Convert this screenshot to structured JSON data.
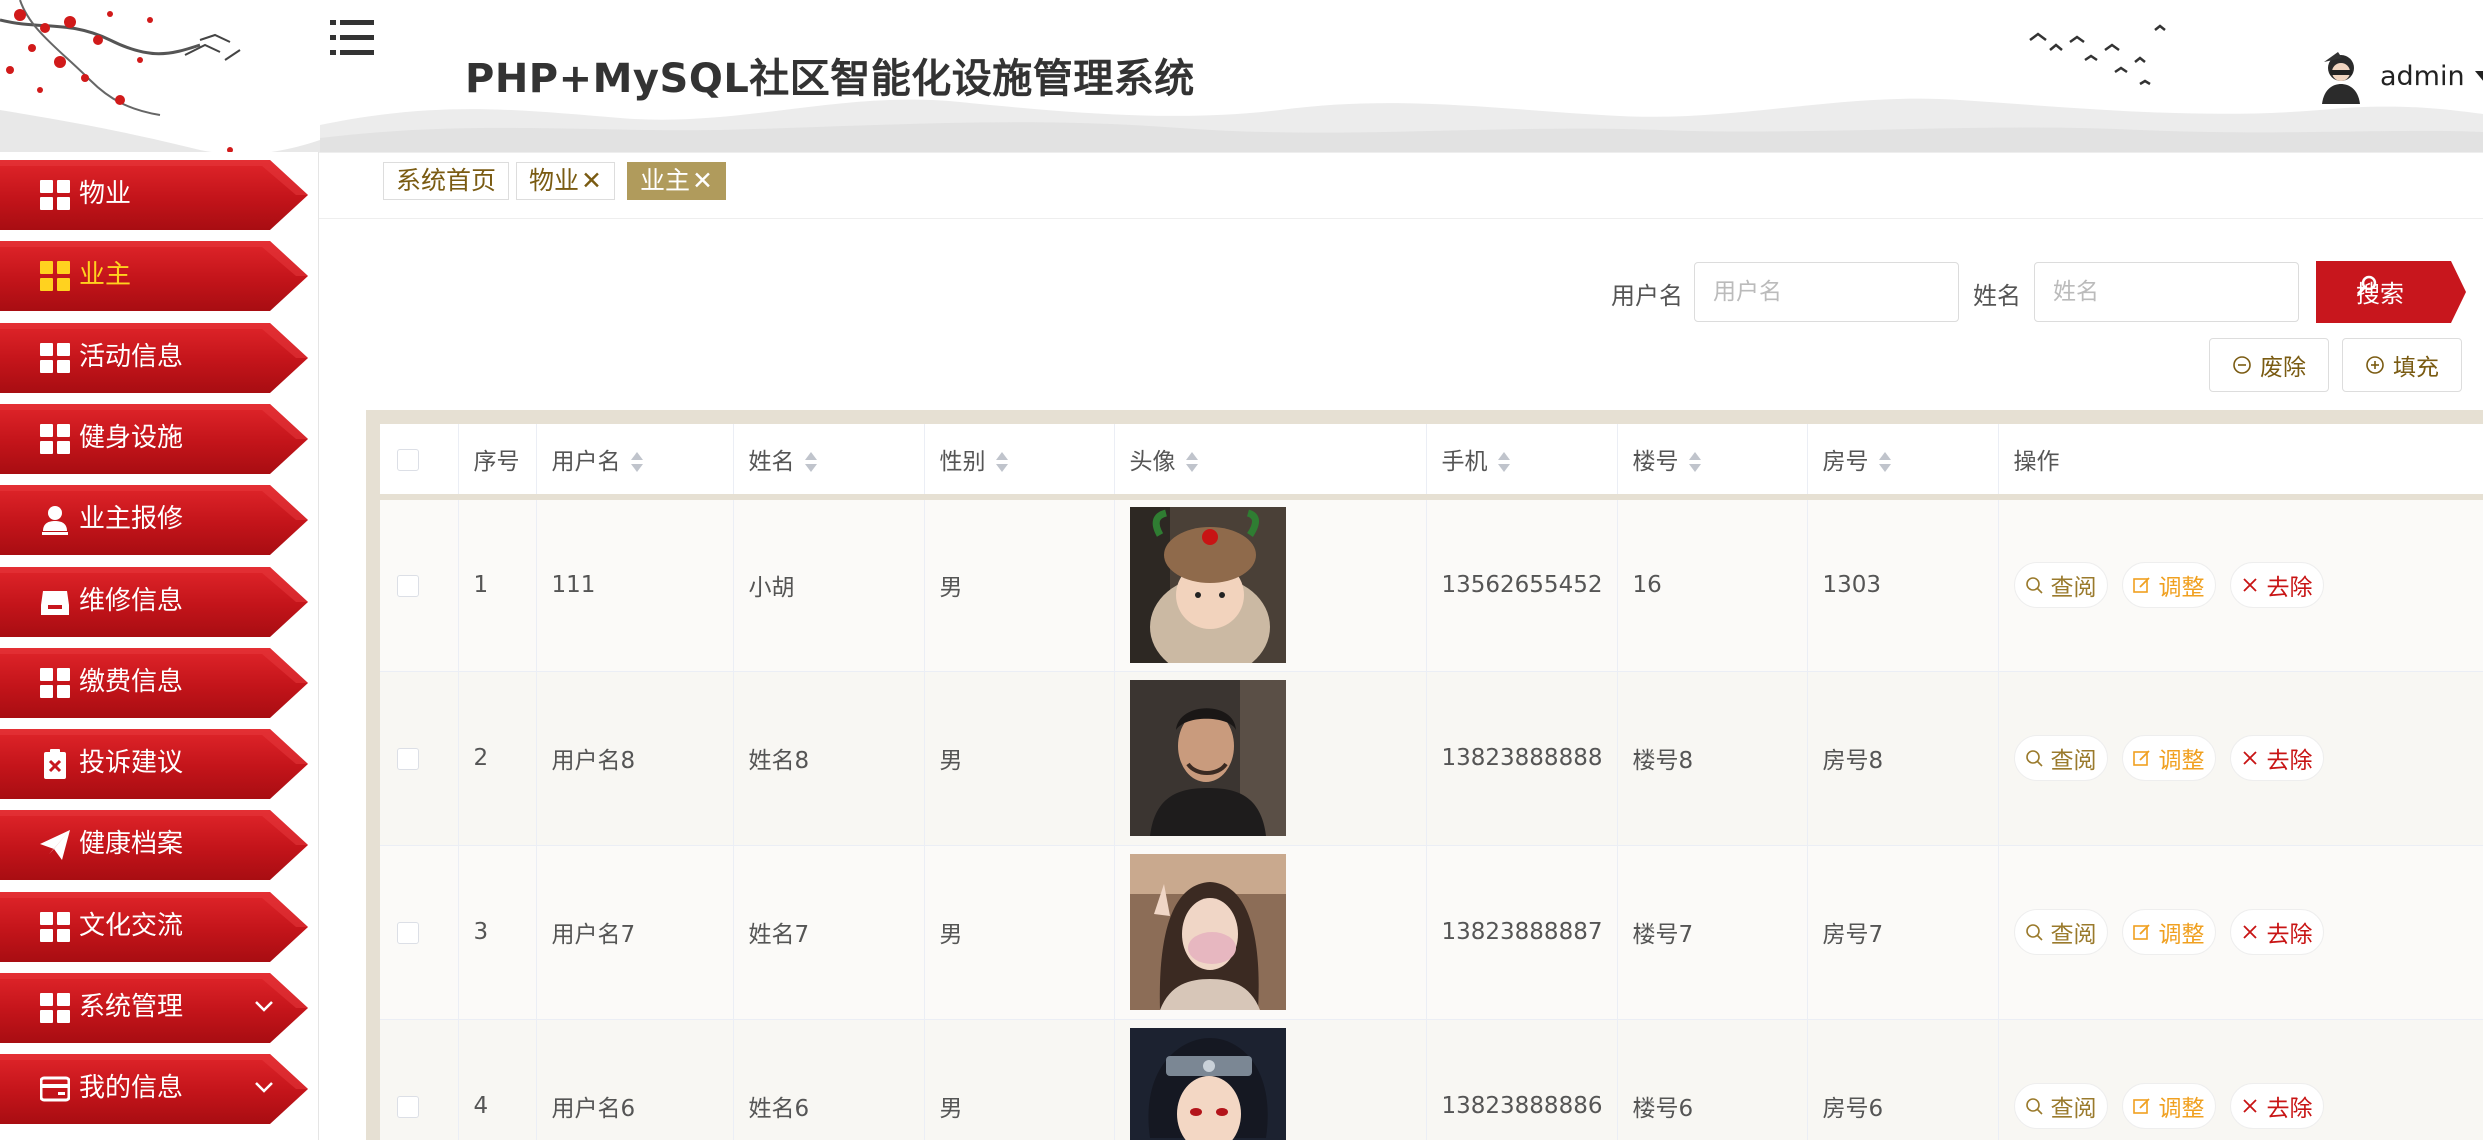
{
  "header": {
    "title": "PHP+MySQL社区智能化设施管理系统",
    "user": "admin"
  },
  "sidebar": {
    "items": [
      {
        "label": "物业",
        "icon": "grid-icon"
      },
      {
        "label": "业主",
        "icon": "grid-icon",
        "active": true
      },
      {
        "label": "活动信息",
        "icon": "grid-icon"
      },
      {
        "label": "健身设施",
        "icon": "grid-icon"
      },
      {
        "label": "业主报修",
        "icon": "person-icon"
      },
      {
        "label": "维修信息",
        "icon": "inbox-icon"
      },
      {
        "label": "缴费信息",
        "icon": "grid-icon"
      },
      {
        "label": "投诉建议",
        "icon": "clipboard-x-icon"
      },
      {
        "label": "健康档案",
        "icon": "paper-plane-icon"
      },
      {
        "label": "文化交流",
        "icon": "grid-icon"
      },
      {
        "label": "系统管理",
        "icon": "grid-icon",
        "expandable": true
      },
      {
        "label": "我的信息",
        "icon": "card-icon",
        "expandable": true
      }
    ]
  },
  "tabs": [
    {
      "label": "系统首页",
      "closable": false
    },
    {
      "label": "物业",
      "closable": true
    },
    {
      "label": "业主",
      "closable": true,
      "active": true
    }
  ],
  "search": {
    "username_label": "用户名",
    "username_placeholder": "用户名",
    "name_label": "姓名",
    "name_placeholder": "姓名",
    "button": "搜索"
  },
  "actions": {
    "delete": "废除",
    "add": "填充"
  },
  "table": {
    "columns": [
      "序号",
      "用户名",
      "姓名",
      "性别",
      "头像",
      "手机",
      "楼号",
      "房号",
      "操作"
    ],
    "rows": [
      {
        "no": "1",
        "username": "111",
        "name": "小胡",
        "gender": "男",
        "phone": "13562655452",
        "building": "16",
        "room": "1303"
      },
      {
        "no": "2",
        "username": "用户名8",
        "name": "姓名8",
        "gender": "男",
        "phone": "13823888888",
        "building": "楼号8",
        "room": "房号8"
      },
      {
        "no": "3",
        "username": "用户名7",
        "name": "姓名7",
        "gender": "男",
        "phone": "13823888887",
        "building": "楼号7",
        "room": "房号7"
      },
      {
        "no": "4",
        "username": "用户名6",
        "name": "姓名6",
        "gender": "男",
        "phone": "13823888886",
        "building": "楼号6",
        "room": "房号6"
      }
    ],
    "row_actions": {
      "view": "查阅",
      "edit": "调整",
      "delete": "去除"
    }
  },
  "colors": {
    "sidebar_red": "#c8161d",
    "active_label": "#ffd21f",
    "tab_active": "#b09b5c",
    "table_frame": "#e6e0d3"
  }
}
